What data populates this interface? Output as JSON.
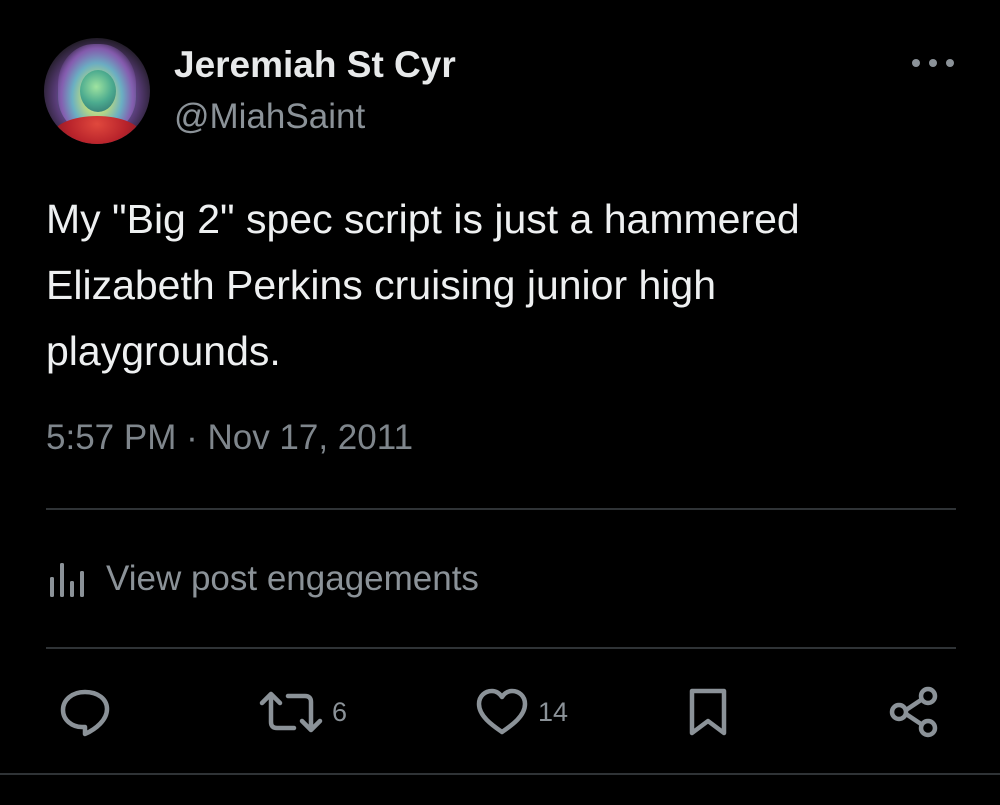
{
  "author": {
    "display_name": "Jeremiah St Cyr",
    "handle": "@MiahSaint"
  },
  "tweet": {
    "text": "My \"Big 2\" spec script is just a hammered Elizabeth Perkins cruising junior high playgrounds.",
    "timestamp": "5:57 PM · Nov 17, 2011"
  },
  "engagements": {
    "label": "View post engagements",
    "icon": "bar-chart-icon"
  },
  "actions": {
    "reply": {
      "icon": "reply-icon",
      "count": ""
    },
    "retweet": {
      "icon": "retweet-icon",
      "count": "6"
    },
    "like": {
      "icon": "heart-icon",
      "count": "14"
    },
    "bookmark": {
      "icon": "bookmark-icon",
      "count": ""
    },
    "share": {
      "icon": "share-icon",
      "count": ""
    }
  },
  "menu": {
    "icon": "more-options-icon"
  },
  "colors": {
    "background": "#000000",
    "primary_text": "#e7e9ea",
    "secondary_text": "#8b9298",
    "divider": "#2f3336"
  }
}
